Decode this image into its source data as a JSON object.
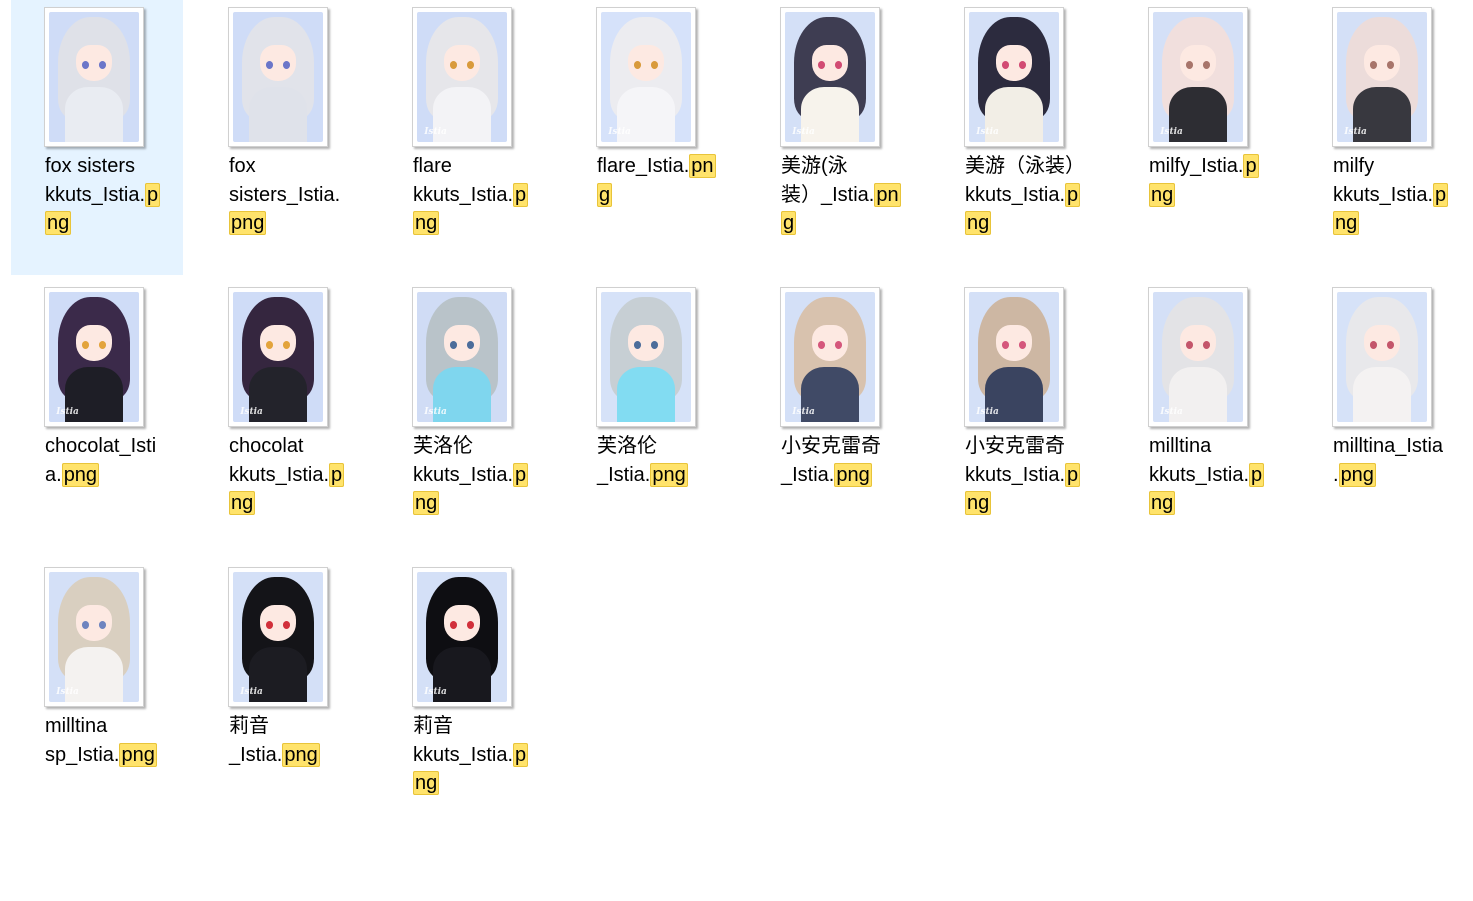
{
  "files": [
    {
      "lines": [
        [
          "fox sisters",
          ""
        ],
        [
          "kkuts_Istia.",
          "p"
        ],
        [
          "",
          "ng"
        ]
      ],
      "selected": true,
      "watermark": "",
      "colors": {
        "bg": "#cfdcf7",
        "hair": "#dfe1e8",
        "body": "#e9ecf2",
        "eye": "#6b76c9"
      }
    },
    {
      "lines": [
        [
          "fox",
          ""
        ],
        [
          "sisters_Istia.",
          ""
        ],
        [
          "",
          "png"
        ]
      ],
      "selected": false,
      "watermark": "",
      "colors": {
        "bg": "#cfdcf7",
        "hair": "#e1e3ea",
        "body": "#dfe2ea",
        "eye": "#6b76c9"
      }
    },
    {
      "lines": [
        [
          "flare",
          ""
        ],
        [
          "kkuts_Istia.",
          "p"
        ],
        [
          "",
          "ng"
        ]
      ],
      "selected": false,
      "watermark": "Istia",
      "colors": {
        "bg": "#cfdcf7",
        "hair": "#e6e6ea",
        "body": "#f3f3f6",
        "eye": "#d99a3b"
      }
    },
    {
      "lines": [
        [
          "flare_Istia.",
          "pn"
        ],
        [
          "",
          "g"
        ]
      ],
      "selected": false,
      "watermark": "Istia",
      "colors": {
        "bg": "#d6e2fa",
        "hair": "#ececf0",
        "body": "#f5f5f8",
        "eye": "#d99a3b"
      }
    },
    {
      "lines": [
        [
          "美游(泳",
          ""
        ],
        [
          "装）_Istia.",
          "pn"
        ],
        [
          "",
          "g"
        ]
      ],
      "selected": false,
      "watermark": "Istia",
      "colors": {
        "bg": "#d4e0f7",
        "hair": "#3e3d52",
        "body": "#f7f3ec",
        "eye": "#d24b73"
      }
    },
    {
      "lines": [
        [
          "美游（泳装）",
          ""
        ],
        [
          "kkuts_Istia.",
          "p"
        ],
        [
          "",
          "ng"
        ]
      ],
      "selected": false,
      "watermark": "Istia",
      "colors": {
        "bg": "#d4e0f7",
        "hair": "#2c2b3e",
        "body": "#f2eee6",
        "eye": "#d24b73"
      }
    },
    {
      "lines": [
        [
          "milfy_Istia.",
          "p"
        ],
        [
          "",
          "ng"
        ]
      ],
      "selected": false,
      "watermark": "Istia",
      "colors": {
        "bg": "#d4e0f7",
        "hair": "#f1dfdd",
        "body": "#2d2d33",
        "eye": "#a8756b"
      }
    },
    {
      "lines": [
        [
          "milfy",
          ""
        ],
        [
          "kkuts_Istia.",
          "p"
        ],
        [
          "",
          "ng"
        ]
      ],
      "selected": false,
      "watermark": "Istia",
      "colors": {
        "bg": "#d4e0f7",
        "hair": "#ecdcda",
        "body": "#38383f",
        "eye": "#a8756b"
      }
    },
    {
      "lines": [
        [
          "chocolat_Isti",
          ""
        ],
        [
          "a.",
          "png"
        ]
      ],
      "selected": false,
      "watermark": "Istia",
      "colors": {
        "bg": "#cfdcf7",
        "hair": "#3b2a4a",
        "body": "#1e1e26",
        "eye": "#e3a43c"
      }
    },
    {
      "lines": [
        [
          "chocolat",
          ""
        ],
        [
          "kkuts_Istia.",
          "p"
        ],
        [
          "",
          "ng"
        ]
      ],
      "selected": false,
      "watermark": "Istia",
      "colors": {
        "bg": "#cfdcf7",
        "hair": "#35263f",
        "body": "#23232b",
        "eye": "#e3a43c"
      }
    },
    {
      "lines": [
        [
          "芙洛伦",
          ""
        ],
        [
          "kkuts_Istia.",
          "p"
        ],
        [
          "",
          "ng"
        ]
      ],
      "selected": false,
      "watermark": "Istia",
      "colors": {
        "bg": "#d0dcf5",
        "hair": "#b9c3c9",
        "body": "#7fd6ee",
        "eye": "#4c6d9b"
      }
    },
    {
      "lines": [
        [
          "芙洛伦",
          ""
        ],
        [
          "_Istia.",
          "png"
        ]
      ],
      "selected": false,
      "watermark": "",
      "colors": {
        "bg": "#d6e2f8",
        "hair": "#c7cfd4",
        "body": "#82dcf2",
        "eye": "#4c6d9b"
      }
    },
    {
      "lines": [
        [
          "小安克雷奇",
          ""
        ],
        [
          "_Istia.",
          "png"
        ]
      ],
      "selected": false,
      "watermark": "Istia",
      "colors": {
        "bg": "#d4e0f7",
        "hair": "#d8c2ae",
        "body": "#404a66",
        "eye": "#d5577c"
      }
    },
    {
      "lines": [
        [
          "小安克雷奇",
          ""
        ],
        [
          "kkuts_Istia.",
          "p"
        ],
        [
          "",
          "ng"
        ]
      ],
      "selected": false,
      "watermark": "Istia",
      "colors": {
        "bg": "#d4e0f7",
        "hair": "#cdb7a3",
        "body": "#3a4460",
        "eye": "#d5577c"
      }
    },
    {
      "lines": [
        [
          "milltina",
          ""
        ],
        [
          "kkuts_Istia.",
          "p"
        ],
        [
          "",
          "ng"
        ]
      ],
      "selected": false,
      "watermark": "Istia",
      "colors": {
        "bg": "#d4e0f7",
        "hair": "#e3e3e6",
        "body": "#f2f0f0",
        "eye": "#c4566b"
      }
    },
    {
      "lines": [
        [
          "milltina_Istia",
          ""
        ],
        [
          ".",
          "png"
        ]
      ],
      "selected": false,
      "watermark": "",
      "colors": {
        "bg": "#d6e2f8",
        "hair": "#e8e8eb",
        "body": "#f4f2f2",
        "eye": "#c4566b"
      }
    },
    {
      "lines": [
        [
          "milltina",
          ""
        ],
        [
          "sp_Istia.",
          "png"
        ]
      ],
      "selected": false,
      "watermark": "Istia",
      "colors": {
        "bg": "#d4e0f7",
        "hair": "#d9cfc0",
        "body": "#f4f2f0",
        "eye": "#6e84bf"
      }
    },
    {
      "lines": [
        [
          "莉音",
          ""
        ],
        [
          "_Istia.",
          "png"
        ]
      ],
      "selected": false,
      "watermark": "Istia",
      "colors": {
        "bg": "#d4e0f7",
        "hair": "#141418",
        "body": "#1c1c22",
        "eye": "#d1303b"
      }
    },
    {
      "lines": [
        [
          "莉音",
          ""
        ],
        [
          "kkuts_Istia.",
          "p"
        ],
        [
          "",
          "ng"
        ]
      ],
      "selected": false,
      "watermark": "Istia",
      "colors": {
        "bg": "#d4e0f7",
        "hair": "#0e0e12",
        "body": "#18181e",
        "eye": "#d1303b"
      }
    }
  ]
}
